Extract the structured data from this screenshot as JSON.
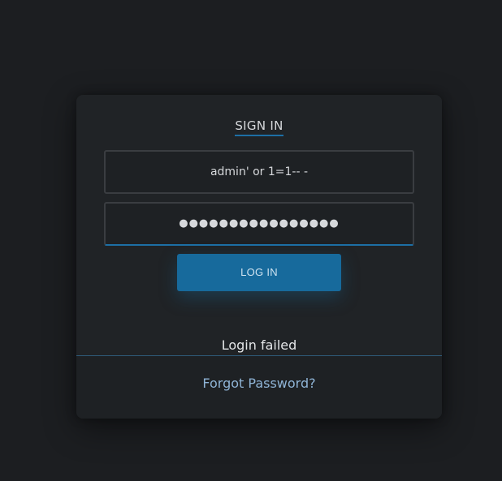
{
  "login_form": {
    "title": "SIGN IN",
    "username_value": "admin' or 1=1-- -",
    "password_value": "●●●●●●●●●●●●●●●●",
    "login_button_label": "LOG IN",
    "status_message": "Login failed",
    "forgot_password_label": "Forgot Password?"
  },
  "colors": {
    "background": "#1c1e21",
    "card": "#202326",
    "accent": "#176a9c",
    "link": "#8fb4d6"
  }
}
